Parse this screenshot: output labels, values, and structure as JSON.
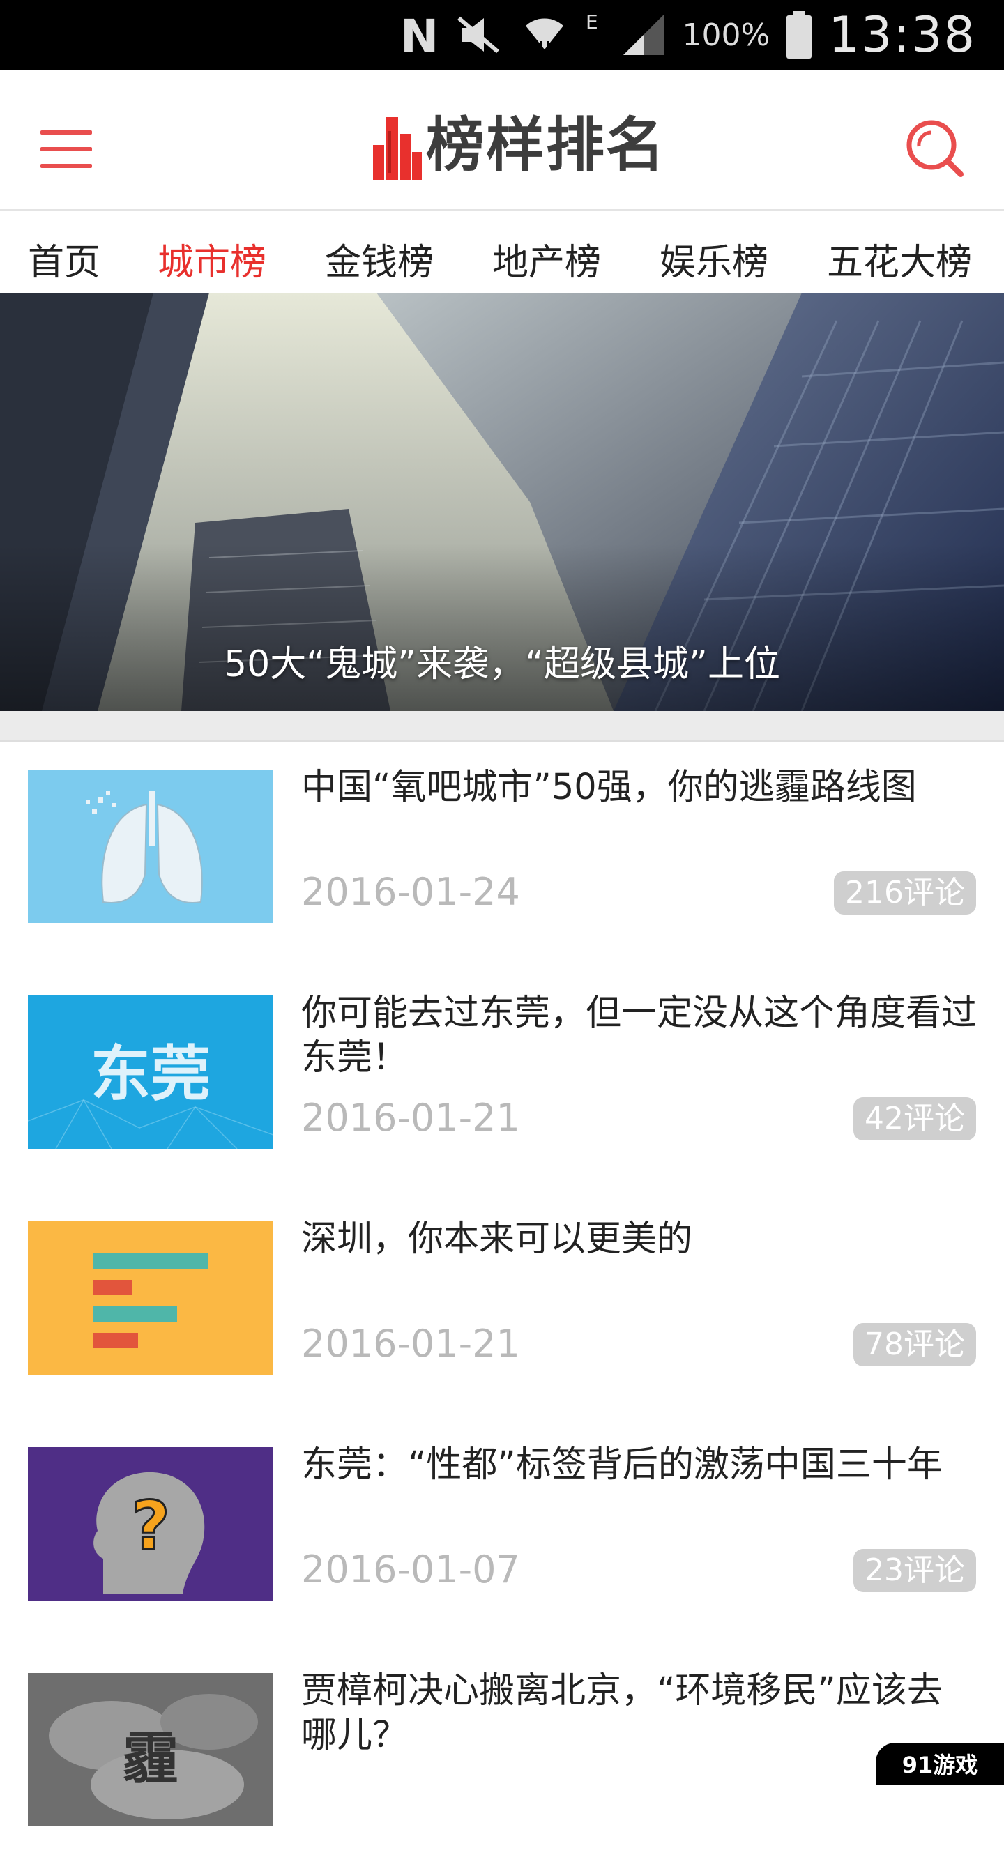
{
  "status_bar": {
    "network_icons": [
      "nfc-icon",
      "mute-icon",
      "wifi-icon",
      "edge-icon",
      "signal-icon"
    ],
    "network_type": "E",
    "battery_percent": "100%",
    "time": "13:38"
  },
  "header": {
    "logo_text": "榜样排名",
    "colors": {
      "accent": "#e8302d",
      "icon": "#e94e4e"
    }
  },
  "tabs": [
    {
      "label": "首页",
      "active": false
    },
    {
      "label": "城市榜",
      "active": true
    },
    {
      "label": "金钱榜",
      "active": false
    },
    {
      "label": "地产榜",
      "active": false
    },
    {
      "label": "娱乐榜",
      "active": false
    },
    {
      "label": "五花大榜",
      "active": false
    }
  ],
  "banner": {
    "caption": "50大“鬼城”来袭，“超级县城”上位"
  },
  "articles": [
    {
      "title": "中国“氧吧城市”50强，你的逃霾路线图",
      "date": "2016-01-24",
      "comments": "216评论",
      "thumb_text": ""
    },
    {
      "title": "你可能去过东莞，但一定没从这个角度看过东莞！",
      "date": "2016-01-21",
      "comments": "42评论",
      "thumb_text": "东莞"
    },
    {
      "title": "深圳，你本来可以更美的",
      "date": "2016-01-21",
      "comments": "78评论",
      "thumb_text": ""
    },
    {
      "title": "东莞：“性都”标签背后的激荡中国三十年",
      "date": "2016-01-07",
      "comments": "23评论",
      "thumb_text": "?"
    },
    {
      "title": "贾樟柯决心搬离北京，“环境移民”应该去哪儿？",
      "date": "",
      "comments": "",
      "thumb_text": "霾"
    }
  ],
  "watermark": {
    "text": "91游戏"
  }
}
